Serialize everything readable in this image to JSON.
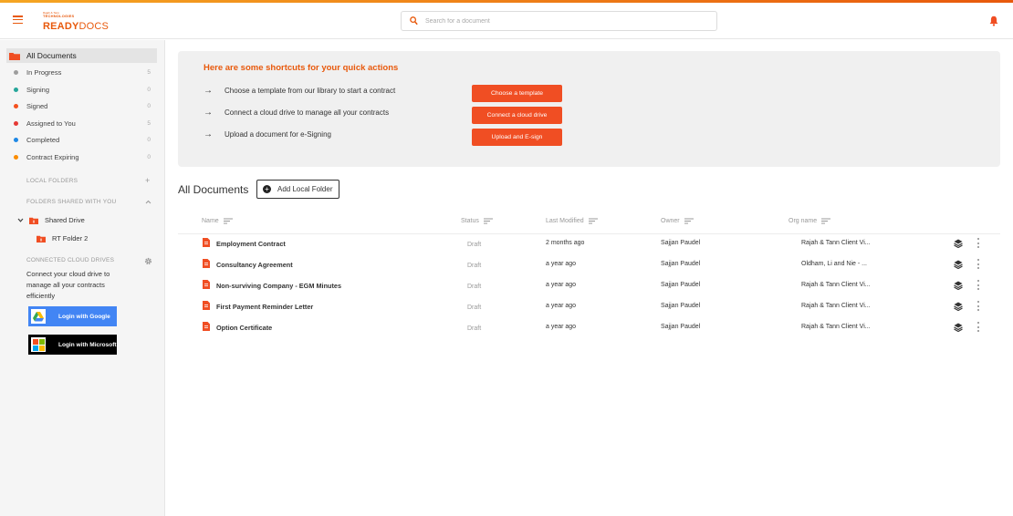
{
  "brand": {
    "line1": "Rajah & Tann",
    "line2": "TECHNOLOGIES",
    "name_a": "READY",
    "name_b": "DOCS",
    "accent": "#e8590c"
  },
  "search": {
    "placeholder": "Search for a document",
    "value": ""
  },
  "sidebar": {
    "all_documents": "All Documents",
    "statuses": [
      {
        "label": "In Progress",
        "count": "5",
        "color": "#9e9e9e"
      },
      {
        "label": "Signing",
        "count": "0",
        "color": "#26a69a"
      },
      {
        "label": "Signed",
        "count": "0",
        "color": "#f4511e"
      },
      {
        "label": "Assigned to You",
        "count": "5",
        "color": "#e53935"
      },
      {
        "label": "Completed",
        "count": "0",
        "color": "#1e88e5"
      },
      {
        "label": "Contract Expiring",
        "count": "0",
        "color": "#fb8c00"
      }
    ],
    "local_folders": "LOCAL FOLDERS",
    "shared_folders": "FOLDERS SHARED WITH YOU",
    "shared_drive": "Shared Drive",
    "rt_folder": "RT Folder 2",
    "cloud_header": "CONNECTED CLOUD DRIVES",
    "cloud_text": "Connect your cloud drive to manage all your contracts efficiently",
    "google_label": "Login with Google",
    "microsoft_label": "Login with Microsoft"
  },
  "shortcuts": {
    "title": "Here are some shortcuts for your quick actions",
    "items": [
      {
        "text": "Choose a template from our library to start a contract",
        "button": "Choose a template"
      },
      {
        "text": "Connect a cloud drive to manage all your contracts",
        "button": "Connect a cloud drive"
      },
      {
        "text": "Upload a document for e-Signing",
        "button": "Upload and E-sign"
      }
    ]
  },
  "main": {
    "title": "All Documents",
    "add_folder": "Add Local Folder",
    "columns": {
      "name": "Name",
      "status": "Status",
      "modified": "Last Modified",
      "owner": "Owner",
      "org": "Org name"
    },
    "rows": [
      {
        "name": "Employment Contract",
        "status": "Draft",
        "modified": "2 months ago",
        "owner": "Sajjan Paudel",
        "org": "Rajah & Tann Client Vi..."
      },
      {
        "name": "Consultancy Agreement",
        "status": "Draft",
        "modified": "a year ago",
        "owner": "Sajjan Paudel",
        "org": "Oldham, Li and Nie - ..."
      },
      {
        "name": "Non-surviving Company - EGM Minutes",
        "status": "Draft",
        "modified": "a year ago",
        "owner": "Sajjan Paudel",
        "org": "Rajah & Tann Client Vi..."
      },
      {
        "name": "First Payment Reminder Letter",
        "status": "Draft",
        "modified": "a year ago",
        "owner": "Sajjan Paudel",
        "org": "Rajah & Tann Client Vi..."
      },
      {
        "name": "Option Certificate",
        "status": "Draft",
        "modified": "a year ago",
        "owner": "Sajjan Paudel",
        "org": "Rajah & Tann Client Vi..."
      }
    ]
  }
}
